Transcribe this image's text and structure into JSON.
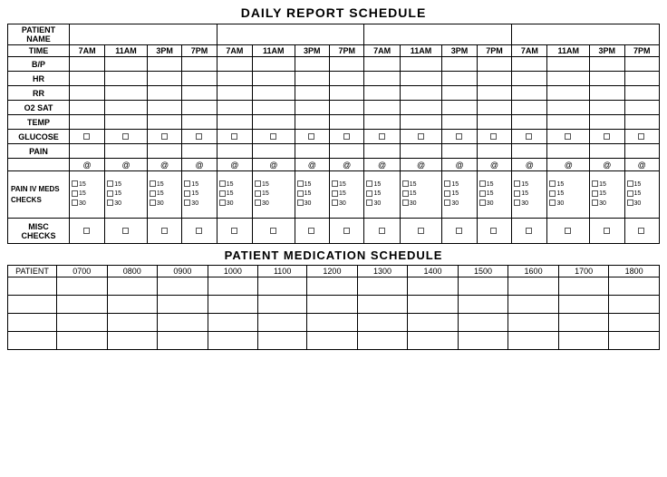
{
  "title": "DAILY REPORT SCHEDULE",
  "med_title": "PATIENT MEDICATION SCHEDULE",
  "report": {
    "patient_name_label": "PATIENT NAME",
    "time_label": "TIME",
    "time_slots": [
      "7AM",
      "11AM",
      "3PM",
      "7PM",
      "7AM",
      "11AM",
      "3PM",
      "7PM",
      "7AM",
      "11AM",
      "3PM",
      "7PM",
      "7AM",
      "11AM",
      "3PM",
      "7PM"
    ],
    "rows": [
      {
        "label": "B/P"
      },
      {
        "label": "HR"
      },
      {
        "label": "RR"
      },
      {
        "label": "O2 SAT"
      },
      {
        "label": "TEMP"
      },
      {
        "label": "GLUCOSE"
      },
      {
        "label": "PAIN"
      }
    ],
    "at_symbol": "@",
    "pain_iv_label": "PAIN IV MEDS\nCHECKS",
    "misc_label": "MISC\nCHECKS",
    "pain_checks": [
      "15",
      "15",
      "30"
    ],
    "at_cols": 16
  },
  "medication": {
    "columns": [
      "PATIENT",
      "0700",
      "0800",
      "0900",
      "1000",
      "1100",
      "1200",
      "1300",
      "1400",
      "1500",
      "1600",
      "1700",
      "1800"
    ],
    "rows": 4
  }
}
